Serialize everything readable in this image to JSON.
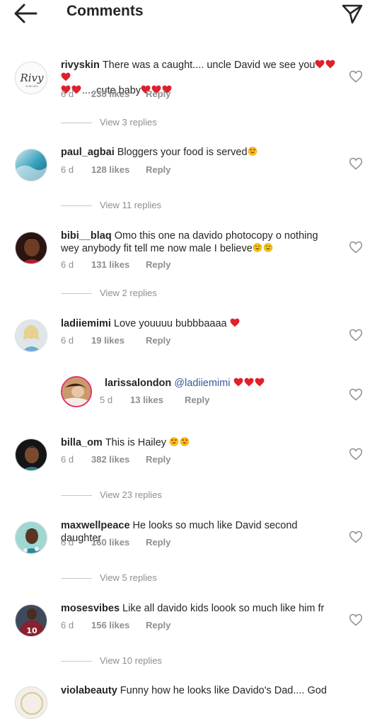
{
  "header": {
    "title": "Comments",
    "back_icon": "arrow-left-icon",
    "send_icon": "paper-plane-icon"
  },
  "labels": {
    "reply": "Reply"
  },
  "colors": {
    "text": "#262626",
    "meta": "#8e8e8e",
    "mention": "#385898",
    "heart_emoji": "#e0202b",
    "smiley_emoji": "#f5c518"
  },
  "comments": [
    {
      "username": "rivyskin",
      "text": "There was a caught.... uncle David we see you",
      "text2": ".....cute baby",
      "time": "6 d",
      "likes": "238 likes",
      "view_replies": "View 3 replies"
    },
    {
      "username": "paul_agbai",
      "text": "Bloggers your food is served",
      "time": "6 d",
      "likes": "128 likes",
      "view_replies": "View 11 replies"
    },
    {
      "username": "bibi__blaq",
      "text": "Omo this one na davido photocopy o nothing wey anybody fit tell me now male I believe",
      "time": "6 d",
      "likes": "131 likes",
      "view_replies": "View 2 replies"
    },
    {
      "username": "ladiiemimi",
      "text": "Love youuuu bubbbaaaa",
      "time": "6 d",
      "likes": "19 likes"
    },
    {
      "username": "larissalondon",
      "mention": "@ladiiemimi",
      "time": "5 d",
      "likes": "13 likes"
    },
    {
      "username": "billa_om",
      "text": "This is Hailey",
      "time": "6 d",
      "likes": "382 likes",
      "view_replies": "View 23 replies"
    },
    {
      "username": "maxwellpeace",
      "text": "He looks so much like David second daughter",
      "time": "6 d",
      "likes": "160 likes",
      "view_replies": "View 5 replies"
    },
    {
      "username": "mosesvibes",
      "text": "Like all davido kids loook so much like him fr",
      "time": "6 d",
      "likes": "156 likes",
      "view_replies": "View 10 replies"
    },
    {
      "username": "violabeauty",
      "text": "Funny how he looks like Davido's Dad.... God"
    }
  ]
}
